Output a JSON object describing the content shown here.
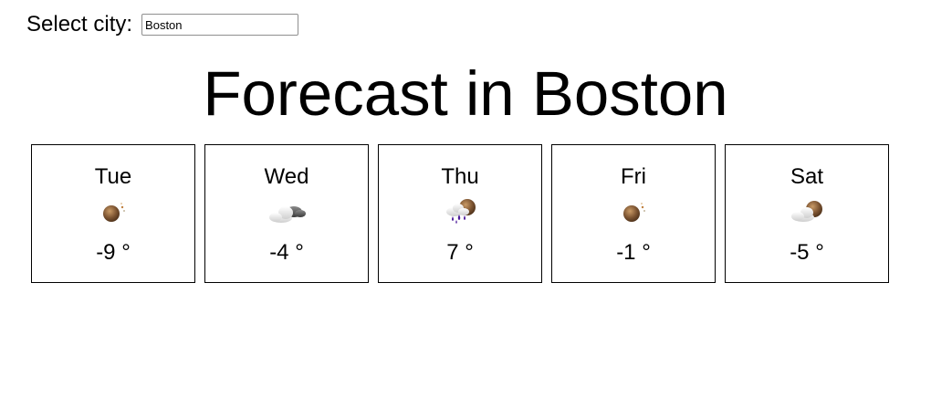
{
  "city_selector": {
    "label": "Select city:",
    "value": "Boston"
  },
  "title": "Forecast in Boston",
  "forecast": [
    {
      "day": "Tue",
      "icon": "clear-night-icon",
      "temp": "-9 °"
    },
    {
      "day": "Wed",
      "icon": "cloud-moon-icon",
      "temp": "-4 °"
    },
    {
      "day": "Thu",
      "icon": "rain-night-icon",
      "temp": "7 °"
    },
    {
      "day": "Fri",
      "icon": "clear-night-icon",
      "temp": "-1 °"
    },
    {
      "day": "Sat",
      "icon": "partly-cloudy-night-icon",
      "temp": "-5 °"
    }
  ],
  "colors": {
    "moon": "#7a5230",
    "cloud": "#e6e6e6",
    "dark_cloud": "#555555",
    "rain": "#4b1a9a"
  }
}
